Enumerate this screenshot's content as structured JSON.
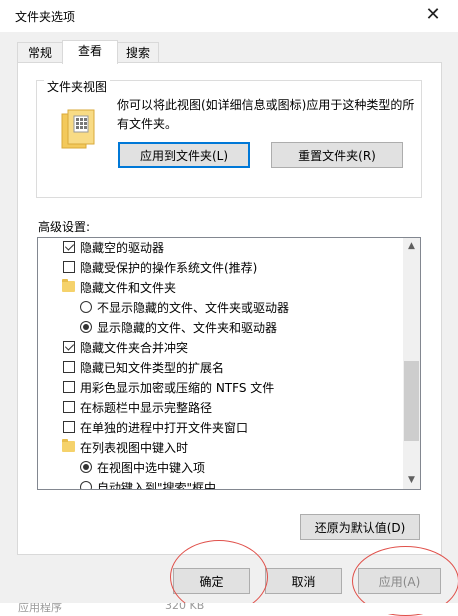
{
  "window": {
    "title": "文件夹选项"
  },
  "tabs": [
    "常规",
    "查看",
    "搜索"
  ],
  "folder_view": {
    "legend": "文件夹视图",
    "description": "你可以将此视图(如详细信息或图标)应用于这种类型的所有文件夹。",
    "apply_button": "应用到文件夹(L)",
    "reset_button": "重置文件夹(R)"
  },
  "advanced": {
    "label": "高级设置:",
    "items": [
      {
        "type": "checkbox",
        "checked": true,
        "label": "隐藏空的驱动器"
      },
      {
        "type": "checkbox",
        "checked": false,
        "label": "隐藏受保护的操作系统文件(推荐)"
      },
      {
        "type": "folder",
        "label": "隐藏文件和文件夹"
      },
      {
        "type": "radio",
        "checked": false,
        "label": "不显示隐藏的文件、文件夹或驱动器"
      },
      {
        "type": "radio",
        "checked": true,
        "label": "显示隐藏的文件、文件夹和驱动器"
      },
      {
        "type": "checkbox",
        "checked": true,
        "label": "隐藏文件夹合并冲突"
      },
      {
        "type": "checkbox",
        "checked": false,
        "label": "隐藏已知文件类型的扩展名"
      },
      {
        "type": "checkbox",
        "checked": false,
        "label": "用彩色显示加密或压缩的 NTFS 文件"
      },
      {
        "type": "checkbox",
        "checked": false,
        "label": "在标题栏中显示完整路径"
      },
      {
        "type": "checkbox",
        "checked": false,
        "label": "在单独的进程中打开文件夹窗口"
      },
      {
        "type": "folder",
        "label": "在列表视图中键入时"
      },
      {
        "type": "radio",
        "checked": true,
        "label": "在视图中选中键入项"
      },
      {
        "type": "radio",
        "checked": false,
        "label": "自动键入到\"搜索\"框中"
      }
    ],
    "restore_button": "还原为默认值(D)"
  },
  "footer": {
    "ok": "确定",
    "cancel": "取消",
    "apply": "应用(A)"
  },
  "background_strip": {
    "name": "应用程序",
    "size": "320 KB"
  },
  "colors": {
    "accent": "#0078d7",
    "annotation": "#e0504a"
  }
}
